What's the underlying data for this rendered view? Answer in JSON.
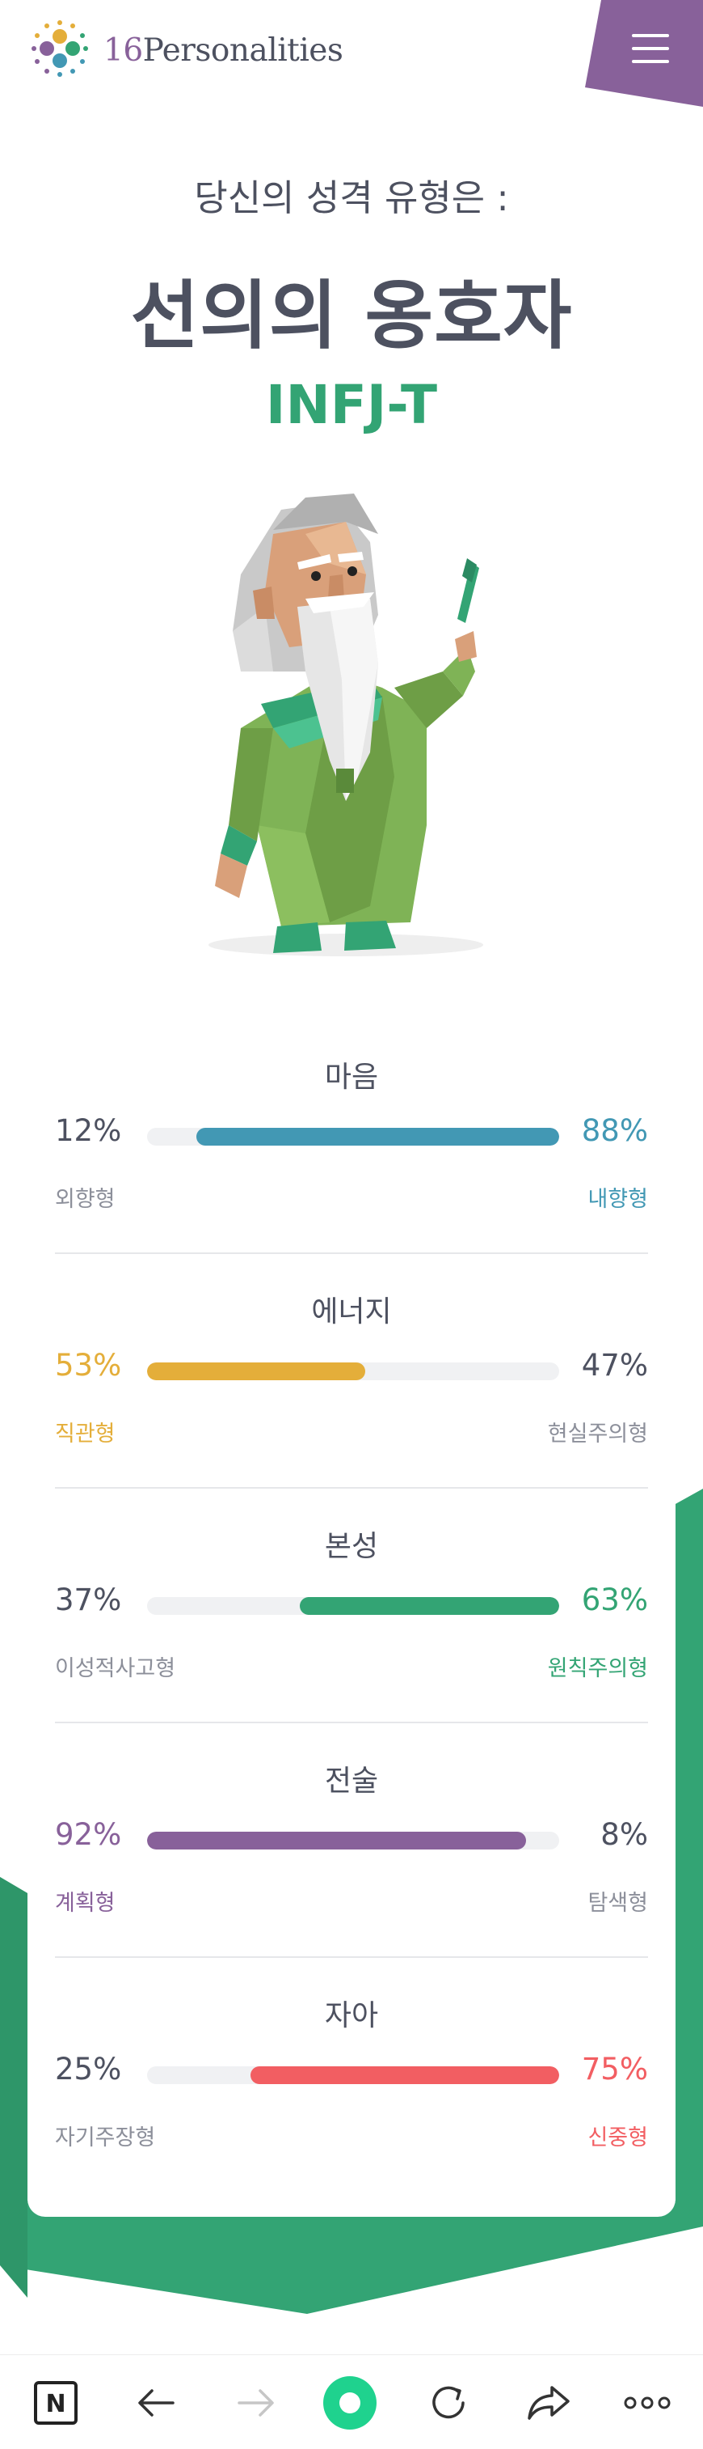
{
  "header": {
    "logo_number": "16",
    "logo_word": "Personalities"
  },
  "hero": {
    "subtitle": "당신의 성격 유형은 :",
    "title": "선의의 옹호자",
    "code": "INFJ-T"
  },
  "traits": [
    {
      "name": "마음",
      "left_pct": "12%",
      "right_pct": "88%",
      "left_label": "외향형",
      "right_label": "내향형",
      "dominant": "right",
      "fill_fraction": 0.88,
      "color": "#4298b4"
    },
    {
      "name": "에너지",
      "left_pct": "53%",
      "right_pct": "47%",
      "left_label": "직관형",
      "right_label": "현실주의형",
      "dominant": "left",
      "fill_fraction": 0.53,
      "color": "#e4ae3a"
    },
    {
      "name": "본성",
      "left_pct": "37%",
      "right_pct": "63%",
      "left_label": "이성적사고형",
      "right_label": "원칙주의형",
      "dominant": "right",
      "fill_fraction": 0.63,
      "color": "#33a474"
    },
    {
      "name": "전술",
      "left_pct": "92%",
      "right_pct": "8%",
      "left_label": "계획형",
      "right_label": "탐색형",
      "dominant": "left",
      "fill_fraction": 0.92,
      "color": "#88619a"
    },
    {
      "name": "자아",
      "left_pct": "25%",
      "right_pct": "75%",
      "left_label": "자기주장형",
      "right_label": "신중형",
      "dominant": "right",
      "fill_fraction": 0.75,
      "color": "#f25e62"
    }
  ],
  "colors": {
    "text": "#4d5160",
    "muted": "#8c8f9a",
    "green": "#33a474",
    "purple": "#88619a"
  },
  "browser_bar": {
    "icons": [
      "n-logo-icon",
      "back-arrow-icon",
      "forward-arrow-icon",
      "home-dot-icon",
      "reload-icon",
      "share-icon",
      "more-dots-icon"
    ]
  }
}
